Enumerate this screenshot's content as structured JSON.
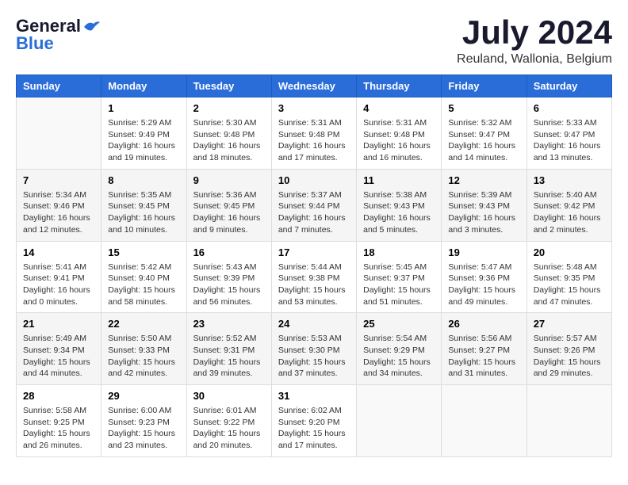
{
  "logo": {
    "general": "General",
    "blue": "Blue"
  },
  "title": "July 2024",
  "location": "Reuland, Wallonia, Belgium",
  "days_of_week": [
    "Sunday",
    "Monday",
    "Tuesday",
    "Wednesday",
    "Thursday",
    "Friday",
    "Saturday"
  ],
  "weeks": [
    [
      {
        "num": "",
        "sunrise": "",
        "sunset": "",
        "daylight": ""
      },
      {
        "num": "1",
        "sunrise": "Sunrise: 5:29 AM",
        "sunset": "Sunset: 9:49 PM",
        "daylight": "Daylight: 16 hours and 19 minutes."
      },
      {
        "num": "2",
        "sunrise": "Sunrise: 5:30 AM",
        "sunset": "Sunset: 9:48 PM",
        "daylight": "Daylight: 16 hours and 18 minutes."
      },
      {
        "num": "3",
        "sunrise": "Sunrise: 5:31 AM",
        "sunset": "Sunset: 9:48 PM",
        "daylight": "Daylight: 16 hours and 17 minutes."
      },
      {
        "num": "4",
        "sunrise": "Sunrise: 5:31 AM",
        "sunset": "Sunset: 9:48 PM",
        "daylight": "Daylight: 16 hours and 16 minutes."
      },
      {
        "num": "5",
        "sunrise": "Sunrise: 5:32 AM",
        "sunset": "Sunset: 9:47 PM",
        "daylight": "Daylight: 16 hours and 14 minutes."
      },
      {
        "num": "6",
        "sunrise": "Sunrise: 5:33 AM",
        "sunset": "Sunset: 9:47 PM",
        "daylight": "Daylight: 16 hours and 13 minutes."
      }
    ],
    [
      {
        "num": "7",
        "sunrise": "Sunrise: 5:34 AM",
        "sunset": "Sunset: 9:46 PM",
        "daylight": "Daylight: 16 hours and 12 minutes."
      },
      {
        "num": "8",
        "sunrise": "Sunrise: 5:35 AM",
        "sunset": "Sunset: 9:45 PM",
        "daylight": "Daylight: 16 hours and 10 minutes."
      },
      {
        "num": "9",
        "sunrise": "Sunrise: 5:36 AM",
        "sunset": "Sunset: 9:45 PM",
        "daylight": "Daylight: 16 hours and 9 minutes."
      },
      {
        "num": "10",
        "sunrise": "Sunrise: 5:37 AM",
        "sunset": "Sunset: 9:44 PM",
        "daylight": "Daylight: 16 hours and 7 minutes."
      },
      {
        "num": "11",
        "sunrise": "Sunrise: 5:38 AM",
        "sunset": "Sunset: 9:43 PM",
        "daylight": "Daylight: 16 hours and 5 minutes."
      },
      {
        "num": "12",
        "sunrise": "Sunrise: 5:39 AM",
        "sunset": "Sunset: 9:43 PM",
        "daylight": "Daylight: 16 hours and 3 minutes."
      },
      {
        "num": "13",
        "sunrise": "Sunrise: 5:40 AM",
        "sunset": "Sunset: 9:42 PM",
        "daylight": "Daylight: 16 hours and 2 minutes."
      }
    ],
    [
      {
        "num": "14",
        "sunrise": "Sunrise: 5:41 AM",
        "sunset": "Sunset: 9:41 PM",
        "daylight": "Daylight: 16 hours and 0 minutes."
      },
      {
        "num": "15",
        "sunrise": "Sunrise: 5:42 AM",
        "sunset": "Sunset: 9:40 PM",
        "daylight": "Daylight: 15 hours and 58 minutes."
      },
      {
        "num": "16",
        "sunrise": "Sunrise: 5:43 AM",
        "sunset": "Sunset: 9:39 PM",
        "daylight": "Daylight: 15 hours and 56 minutes."
      },
      {
        "num": "17",
        "sunrise": "Sunrise: 5:44 AM",
        "sunset": "Sunset: 9:38 PM",
        "daylight": "Daylight: 15 hours and 53 minutes."
      },
      {
        "num": "18",
        "sunrise": "Sunrise: 5:45 AM",
        "sunset": "Sunset: 9:37 PM",
        "daylight": "Daylight: 15 hours and 51 minutes."
      },
      {
        "num": "19",
        "sunrise": "Sunrise: 5:47 AM",
        "sunset": "Sunset: 9:36 PM",
        "daylight": "Daylight: 15 hours and 49 minutes."
      },
      {
        "num": "20",
        "sunrise": "Sunrise: 5:48 AM",
        "sunset": "Sunset: 9:35 PM",
        "daylight": "Daylight: 15 hours and 47 minutes."
      }
    ],
    [
      {
        "num": "21",
        "sunrise": "Sunrise: 5:49 AM",
        "sunset": "Sunset: 9:34 PM",
        "daylight": "Daylight: 15 hours and 44 minutes."
      },
      {
        "num": "22",
        "sunrise": "Sunrise: 5:50 AM",
        "sunset": "Sunset: 9:33 PM",
        "daylight": "Daylight: 15 hours and 42 minutes."
      },
      {
        "num": "23",
        "sunrise": "Sunrise: 5:52 AM",
        "sunset": "Sunset: 9:31 PM",
        "daylight": "Daylight: 15 hours and 39 minutes."
      },
      {
        "num": "24",
        "sunrise": "Sunrise: 5:53 AM",
        "sunset": "Sunset: 9:30 PM",
        "daylight": "Daylight: 15 hours and 37 minutes."
      },
      {
        "num": "25",
        "sunrise": "Sunrise: 5:54 AM",
        "sunset": "Sunset: 9:29 PM",
        "daylight": "Daylight: 15 hours and 34 minutes."
      },
      {
        "num": "26",
        "sunrise": "Sunrise: 5:56 AM",
        "sunset": "Sunset: 9:27 PM",
        "daylight": "Daylight: 15 hours and 31 minutes."
      },
      {
        "num": "27",
        "sunrise": "Sunrise: 5:57 AM",
        "sunset": "Sunset: 9:26 PM",
        "daylight": "Daylight: 15 hours and 29 minutes."
      }
    ],
    [
      {
        "num": "28",
        "sunrise": "Sunrise: 5:58 AM",
        "sunset": "Sunset: 9:25 PM",
        "daylight": "Daylight: 15 hours and 26 minutes."
      },
      {
        "num": "29",
        "sunrise": "Sunrise: 6:00 AM",
        "sunset": "Sunset: 9:23 PM",
        "daylight": "Daylight: 15 hours and 23 minutes."
      },
      {
        "num": "30",
        "sunrise": "Sunrise: 6:01 AM",
        "sunset": "Sunset: 9:22 PM",
        "daylight": "Daylight: 15 hours and 20 minutes."
      },
      {
        "num": "31",
        "sunrise": "Sunrise: 6:02 AM",
        "sunset": "Sunset: 9:20 PM",
        "daylight": "Daylight: 15 hours and 17 minutes."
      },
      {
        "num": "",
        "sunrise": "",
        "sunset": "",
        "daylight": ""
      },
      {
        "num": "",
        "sunrise": "",
        "sunset": "",
        "daylight": ""
      },
      {
        "num": "",
        "sunrise": "",
        "sunset": "",
        "daylight": ""
      }
    ]
  ]
}
